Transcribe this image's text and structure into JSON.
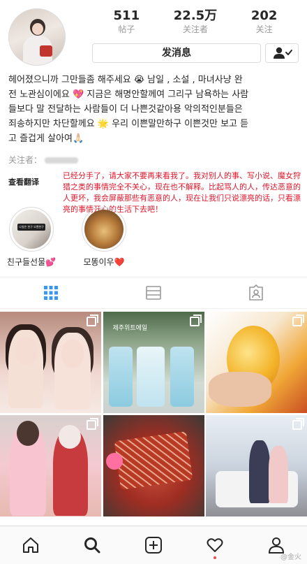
{
  "profile": {
    "stats": [
      {
        "value": "511",
        "label": "帖子"
      },
      {
        "value": "22.5万",
        "label": "关注者"
      },
      {
        "value": "202",
        "label": "关注"
      }
    ],
    "message_button": "发消息",
    "bio_lines": [
      "헤어졌으니까 그만들좀 해주세요 😭 남일 , 소설 , 마녀사냥 완",
      "전 노관심이에요 💖 지금은 해명안할께여 그리구 남욕하는 사람",
      "들보다 말 전달하는 사람들이 더 나쁜것같아용 악의적인분들은",
      "죄송하지만 차단할께요 🌟 우리 이쁜말만하구 이쁜것만 보고 듣",
      "고 즐겁게 살아여🙏🏻"
    ],
    "followed_by_label": "关注者：",
    "translate_label": "查看翻译"
  },
  "overlay_caption": "已经分手了，请大家不要再来看我了。我对别人的事、写小说、魔女狩猎之类的事情完全不关心，现在也不解释。比起骂人的人，传达恶意的人更坏，我会屏蔽那些有恶意的人，现在让我们只说漂亮的话，只看漂亮的事情开心的生活下去吧！",
  "highlights": [
    {
      "label": "친구들선물💕",
      "image_text": "나일은 친구 오랜친구"
    },
    {
      "label": "모똥이우❤️"
    }
  ],
  "grid": {
    "post2_sign": "제주위트에일"
  },
  "watermark": "@金火",
  "icons": {
    "tab_grid": "grid-icon",
    "tab_list": "list-icon",
    "tab_tagged": "tagged-icon",
    "nav": [
      "home-icon",
      "search-icon",
      "new-post-icon",
      "activity-heart-icon",
      "profile-icon"
    ],
    "multi_post": "carousel-icon"
  },
  "colors": {
    "accent_blue": "#3897f0",
    "overlay_red": "#e0162b",
    "notification_dot": "#ed4956"
  }
}
